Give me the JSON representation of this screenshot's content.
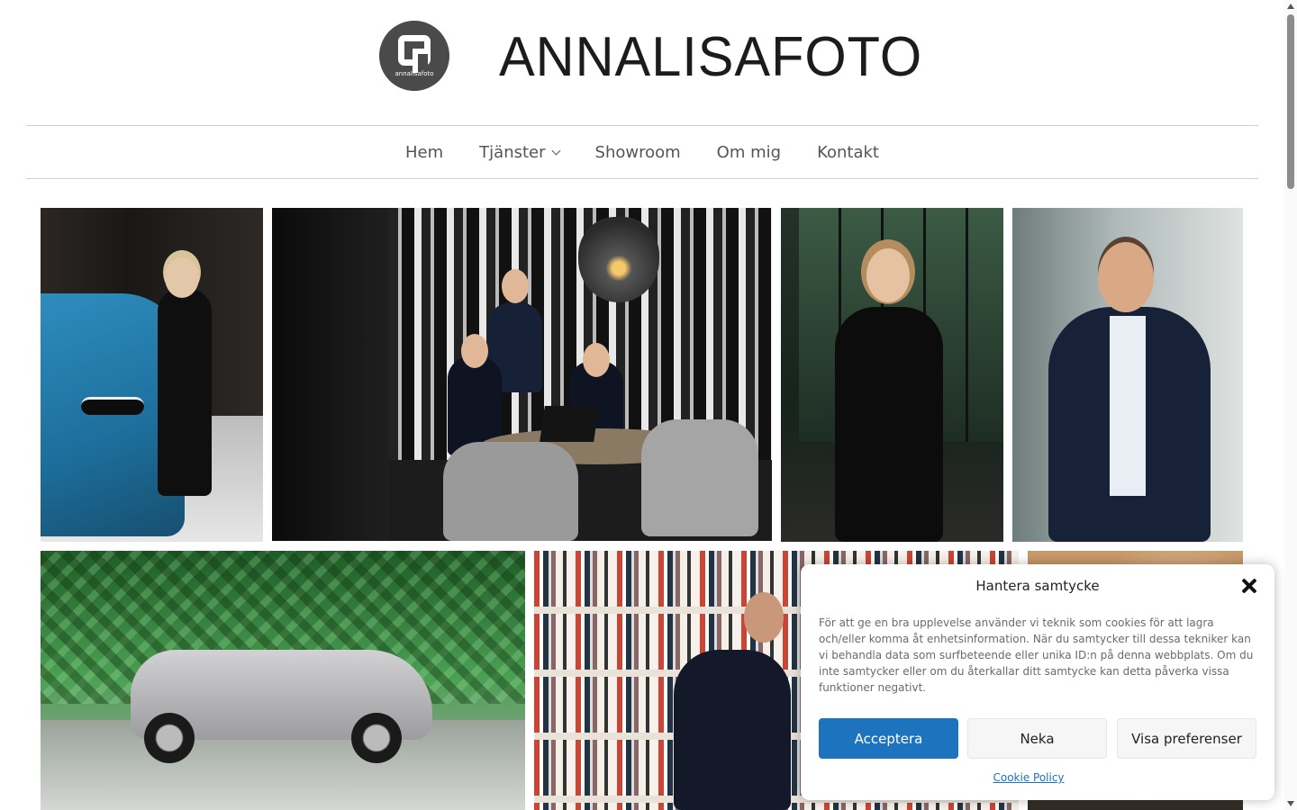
{
  "header": {
    "logo_badge_text": "annalisafoto",
    "logo_text": "ANNALISAFOTO"
  },
  "nav": {
    "items": [
      {
        "label": "Hem"
      },
      {
        "label": "Tjänster"
      },
      {
        "label": "Showroom"
      },
      {
        "label": "Om mig"
      },
      {
        "label": "Kontakt"
      }
    ]
  },
  "gallery": {
    "photos": [
      {
        "subject": "woman leaning on blue car"
      },
      {
        "subject": "three men at meeting table"
      },
      {
        "subject": "woman portrait by window"
      },
      {
        "subject": "man portrait arms crossed"
      },
      {
        "subject": "silver car in green lab"
      },
      {
        "subject": "man seated by bookshelves"
      },
      {
        "subject": "partial portrait"
      }
    ]
  },
  "cookie_dialog": {
    "title": "Hantera samtycke",
    "body": "För att ge en bra upplevelse använder vi teknik som cookies för att lagra och/eller komma åt enhetsinformation. När du samtycker till dessa tekniker kan vi behandla data som surfbeteende eller unika ID:n på denna webbplats. Om du inte samtycker eller om du återkallar ditt samtycke kan detta påverka vissa funktioner negativt.",
    "accept_label": "Acceptera",
    "deny_label": "Neka",
    "prefs_label": "Visa preferenser",
    "policy_link": "Cookie Policy"
  },
  "colors": {
    "accent": "#1e73be",
    "nav_text": "#555555"
  }
}
